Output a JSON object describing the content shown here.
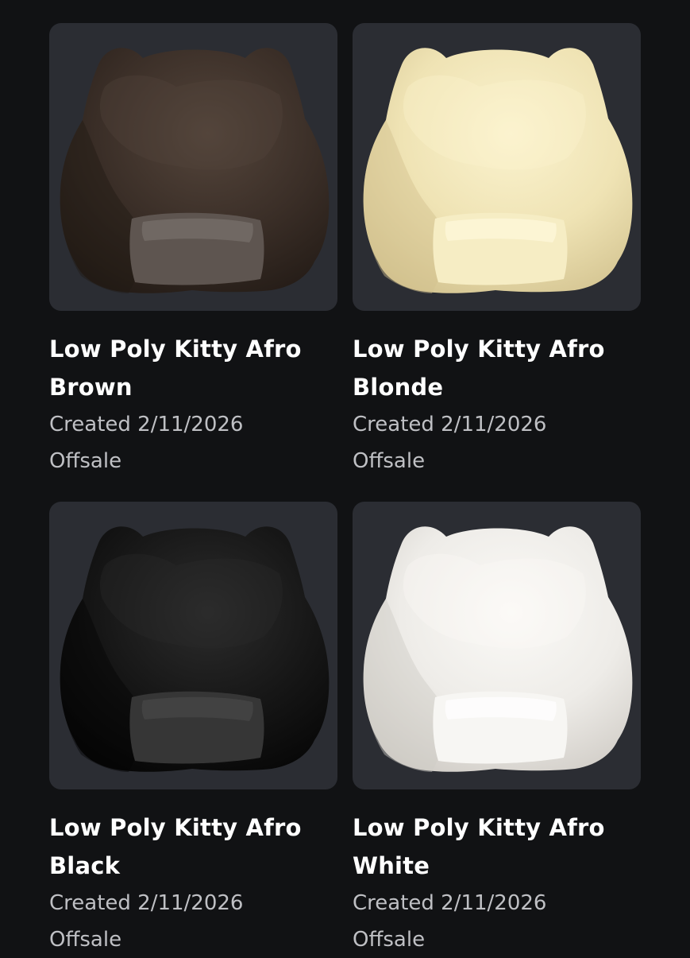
{
  "items": [
    {
      "name_line1": "Low Poly Kitty Afro",
      "name_line2": "Brown",
      "created": "Created 2/11/2026",
      "status": "Offsale",
      "colors": {
        "base": "#3a2e27",
        "light": "#54453b",
        "dark": "#221a15",
        "inner": "#5e5550",
        "innerLight": "#77706b"
      }
    },
    {
      "name_line1": "Low Poly Kitty Afro",
      "name_line2": "Blonde",
      "created": "Created 2/11/2026",
      "status": "Offsale",
      "colors": {
        "base": "#efe3b4",
        "light": "#fbf3cf",
        "dark": "#d2c28f",
        "inner": "#f6edc4",
        "innerLight": "#fff8db"
      }
    },
    {
      "name_line1": "Low Poly Kitty Afro",
      "name_line2": "Black",
      "created": "Created 2/11/2026",
      "status": "Offsale",
      "colors": {
        "base": "#161616",
        "light": "#2c2c2c",
        "dark": "#050505",
        "inner": "#363636",
        "innerLight": "#474747"
      }
    },
    {
      "name_line1": "Low Poly Kitty Afro",
      "name_line2": "White",
      "created": "Created 2/11/2026",
      "status": "Offsale",
      "colors": {
        "base": "#eeece8",
        "light": "#fbfaf7",
        "dark": "#cfcbc5",
        "inner": "#f7f6f3",
        "innerLight": "#ffffff"
      }
    }
  ]
}
